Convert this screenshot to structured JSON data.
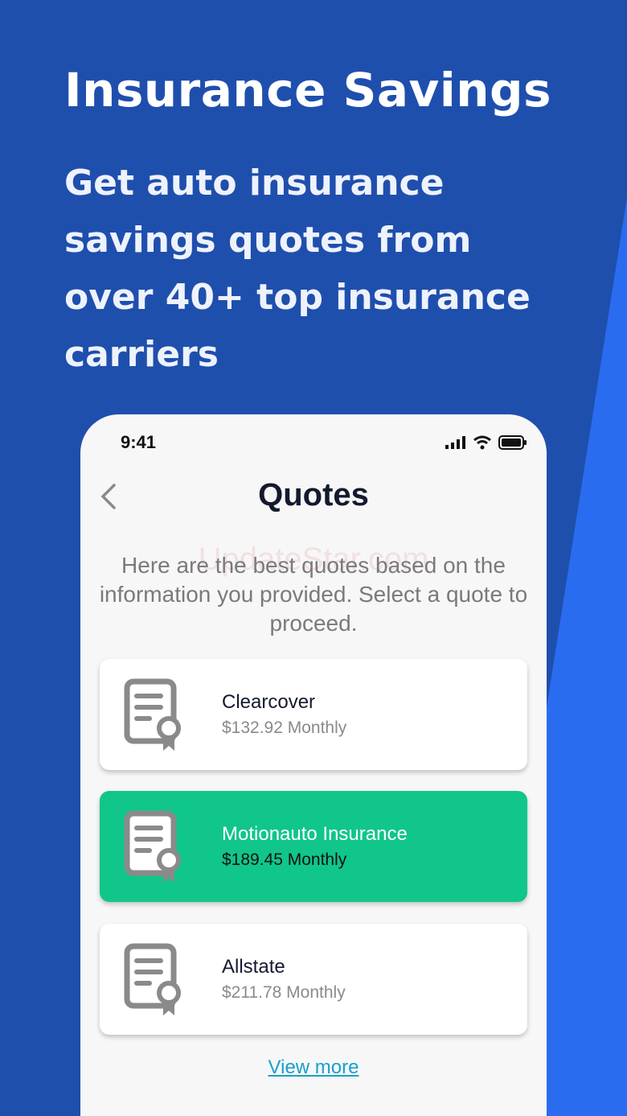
{
  "promo": {
    "headline": "Insurance Savings",
    "subhead": "Get auto insurance savings quotes from over 40+ top insurance carriers"
  },
  "status_bar": {
    "time": "9:41",
    "icons": [
      "signal-icon",
      "wifi-icon",
      "battery-icon"
    ]
  },
  "screen": {
    "title": "Quotes",
    "intro": "Here are the best quotes based on the information you provided. Select a quote to proceed.",
    "watermark": "UpdateStar.com",
    "quotes": [
      {
        "name": "Clearcover",
        "price": "$132.92 Monthly",
        "selected": false
      },
      {
        "name": "Motionauto Insurance",
        "price": "$189.45 Monthly",
        "selected": true
      },
      {
        "name": "Allstate",
        "price": "$211.78 Monthly",
        "selected": false
      }
    ],
    "view_more": "View more"
  },
  "colors": {
    "background": "#1f4fad",
    "accent_stripe": "#2a6cf0",
    "selected_card": "#10c68a",
    "link": "#1aa0c8"
  }
}
